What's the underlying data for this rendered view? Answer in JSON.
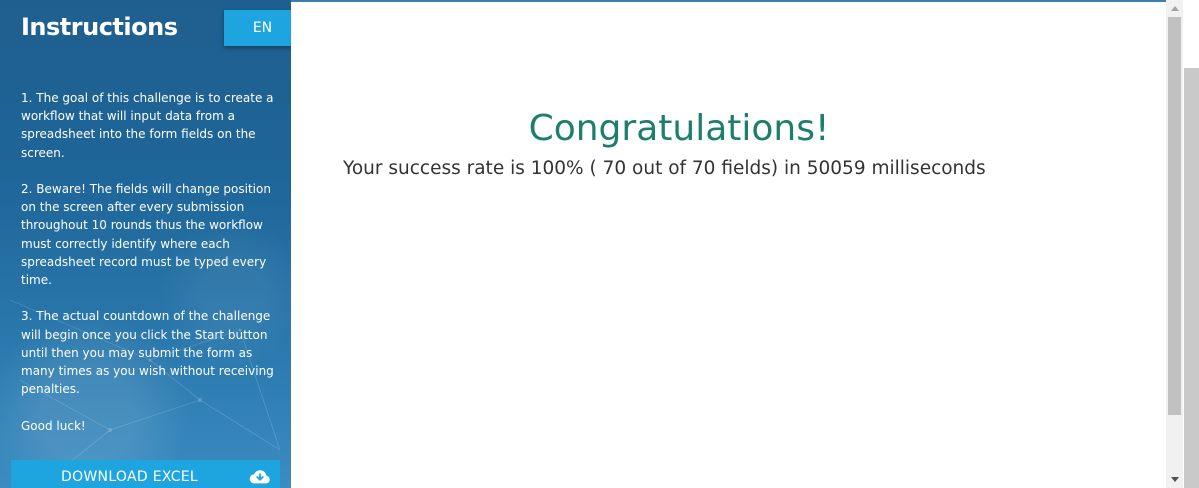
{
  "sidebar": {
    "title": "Instructions",
    "language_button": "EN",
    "instructions": [
      "1. The goal of this challenge is to create a workflow that will input data from a spreadsheet into the form fields on the screen.",
      "2. Beware! The fields will change position on the screen after every submission throughout 10 rounds thus the workflow must correctly identify where each spreadsheet record must be typed every time.",
      "3. The actual countdown of the challenge will begin once you click the Start button until then you may submit the form as many times as you wish without receiving penalties.",
      "Good luck!"
    ],
    "download_button": "DOWNLOAD EXCEL",
    "download_icon": "cloud-download-icon"
  },
  "main": {
    "heading": "Congratulations!",
    "result_text": "Your success rate is 100% ( 70 out of 70 fields) in 50059 milliseconds"
  },
  "colors": {
    "accent": "#1ea5e0",
    "heading": "#1e7e6c",
    "sidebar_dark": "#1f5f8f"
  }
}
